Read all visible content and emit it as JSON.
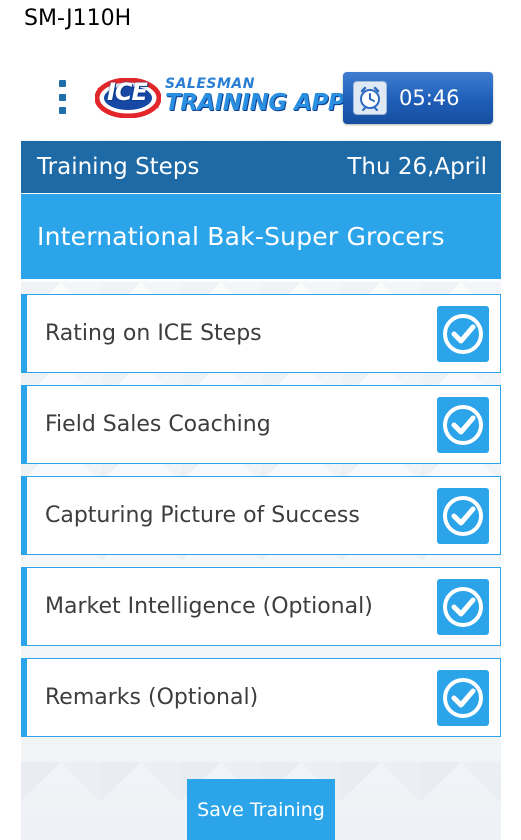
{
  "device": {
    "model": "SM-J110H"
  },
  "app": {
    "logo_ice": "ICE",
    "logo_sub": "SALESMAN",
    "logo_main": "TRAINING APP",
    "timer": "05:46"
  },
  "header": {
    "title": "Training Steps",
    "date": "Thu 26,April"
  },
  "store": {
    "name": "International Bak-Super Grocers"
  },
  "steps": [
    {
      "label": "Rating on ICE Steps",
      "checked": true
    },
    {
      "label": "Field Sales Coaching",
      "checked": true
    },
    {
      "label": "Capturing Picture of Success",
      "checked": true
    },
    {
      "label": "Market Intelligence (Optional)",
      "checked": true
    },
    {
      "label": "Remarks (Optional)",
      "checked": true
    }
  ],
  "actions": {
    "save_label": "Save Training"
  },
  "colors": {
    "header_dark_blue": "#1e6aa6",
    "accent_blue": "#2ba4ea",
    "timer_blue": "#1e5eb8"
  },
  "icons": {
    "menu": "overflow-menu-icon",
    "timer": "alarm-clock-icon",
    "check": "check-icon"
  }
}
